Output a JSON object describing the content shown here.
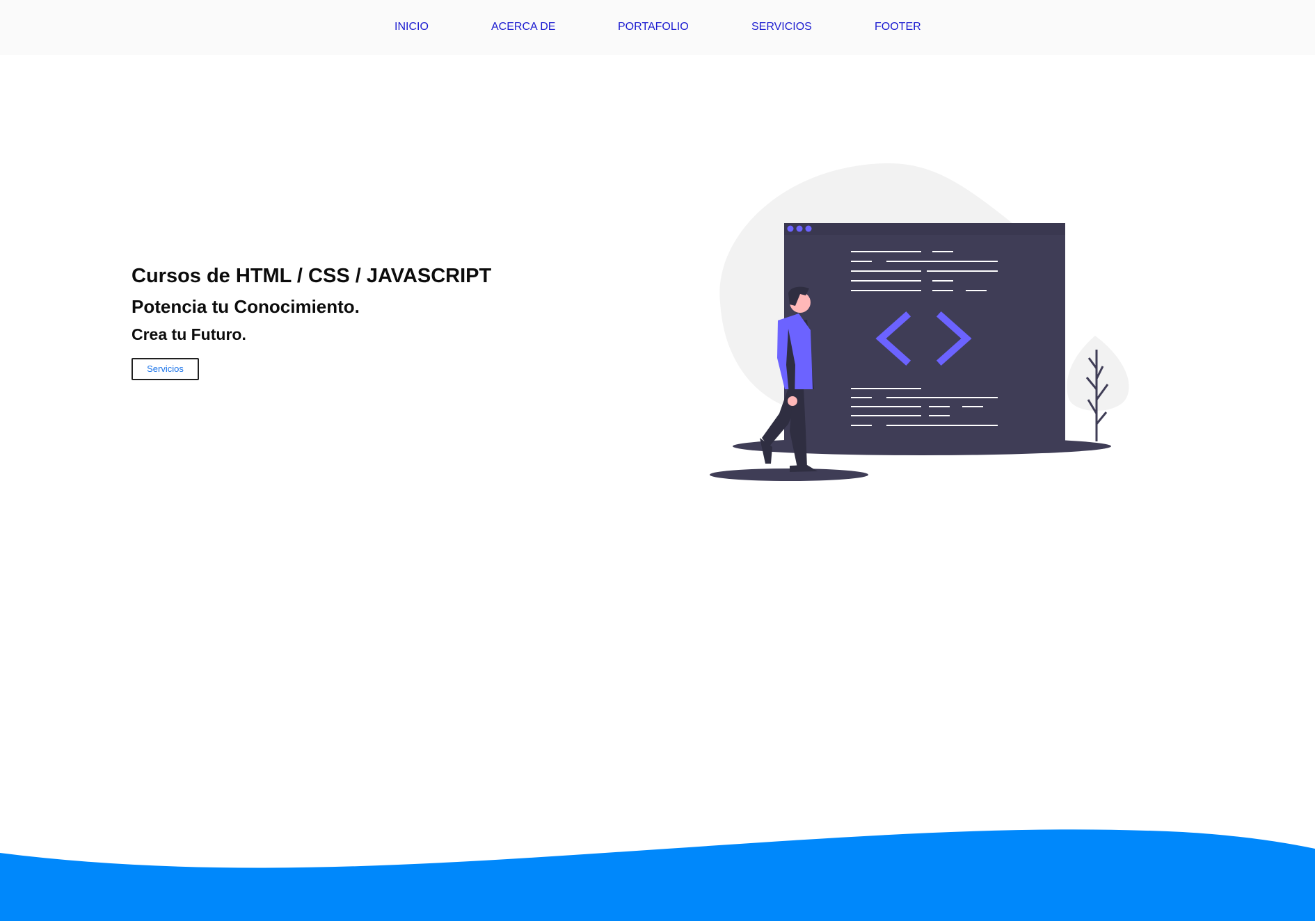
{
  "nav": {
    "items": [
      {
        "label": "INICIO"
      },
      {
        "label": "ACERCA DE"
      },
      {
        "label": "PORTAFOLIO"
      },
      {
        "label": "SERVICIOS"
      },
      {
        "label": "FOOTER"
      }
    ]
  },
  "hero": {
    "title": "Cursos de HTML / CSS / JAVASCRIPT",
    "subtitle": "Potencia tu Conocimiento.",
    "tagline": "Crea tu Futuro.",
    "button_label": "Servicios"
  },
  "illustration": {
    "icon": "programmer-code-window-illustration"
  },
  "colors": {
    "nav_link": "#1a1ad0",
    "accent_purple": "#6c63ff",
    "window_dark": "#3f3d56",
    "wave_blue": "#0088fb",
    "blob_gray": "#f2f2f2"
  }
}
